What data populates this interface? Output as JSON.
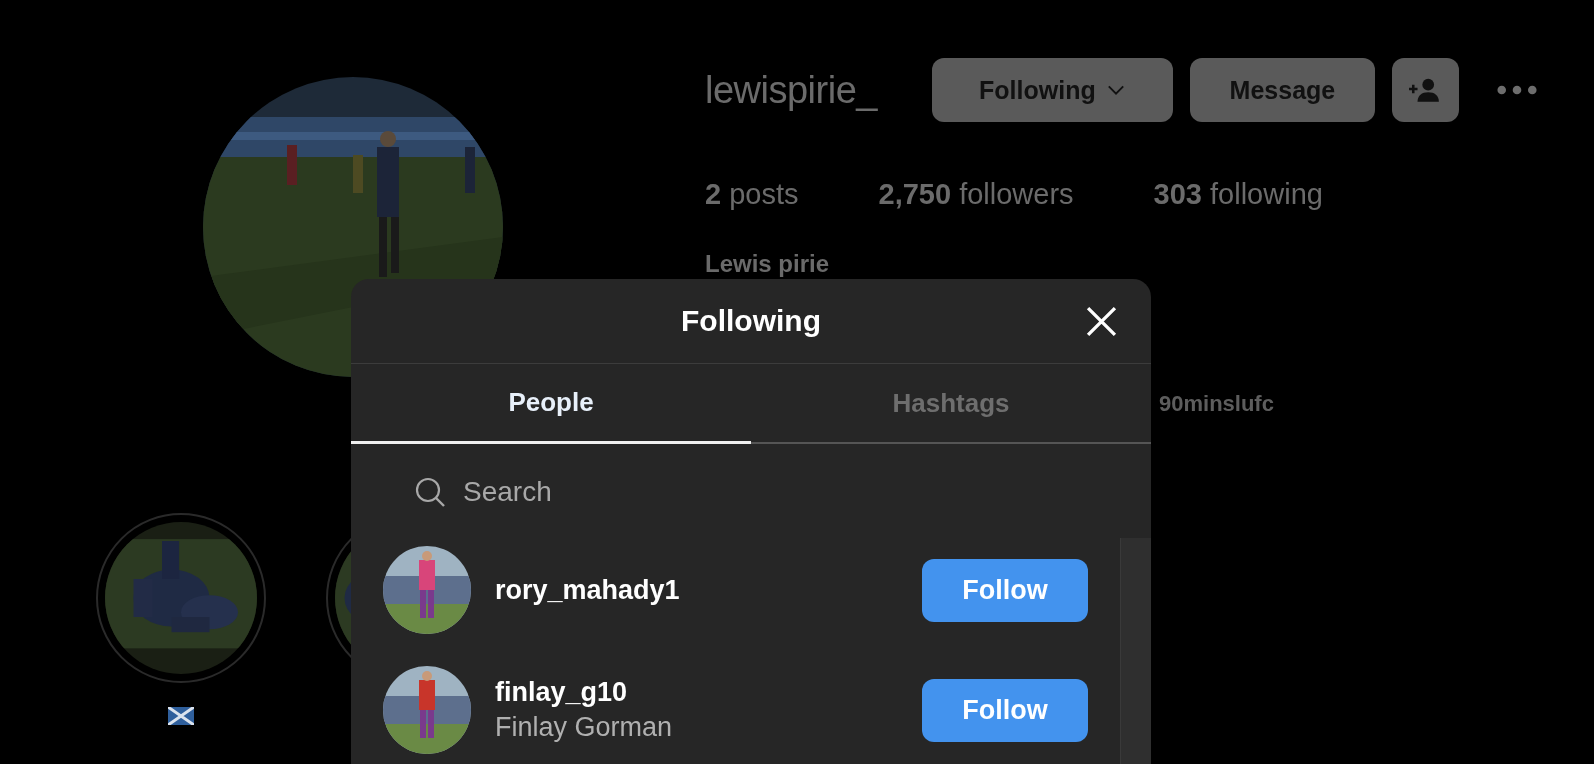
{
  "profile": {
    "username": "lewispirie_",
    "buttons": [
      {
        "kind": "dropdown",
        "label": "Following"
      },
      {
        "kind": "text",
        "label": "Message"
      },
      {
        "kind": "add-person"
      }
    ],
    "stats": [
      {
        "count": "2",
        "label": "posts"
      },
      {
        "count": "2,750",
        "label": "followers"
      },
      {
        "count": "303",
        "label": "following"
      }
    ],
    "full_name": "Lewis pirie",
    "link": "90minslufc",
    "highlights": [
      {
        "kind": "flag"
      },
      {
        "kind": "plain"
      }
    ]
  },
  "dialog": {
    "title": "Following",
    "tabs": [
      {
        "label": "People",
        "selected": true
      },
      {
        "label": "Hashtags",
        "selected": false
      }
    ],
    "search": {
      "placeholder": "Search"
    },
    "accounts": [
      {
        "username": "rory_mahady1",
        "button": "Follow"
      },
      {
        "username": "finlay_g10",
        "full_name": "Finlay Gorman",
        "button": "Follow"
      }
    ]
  }
}
